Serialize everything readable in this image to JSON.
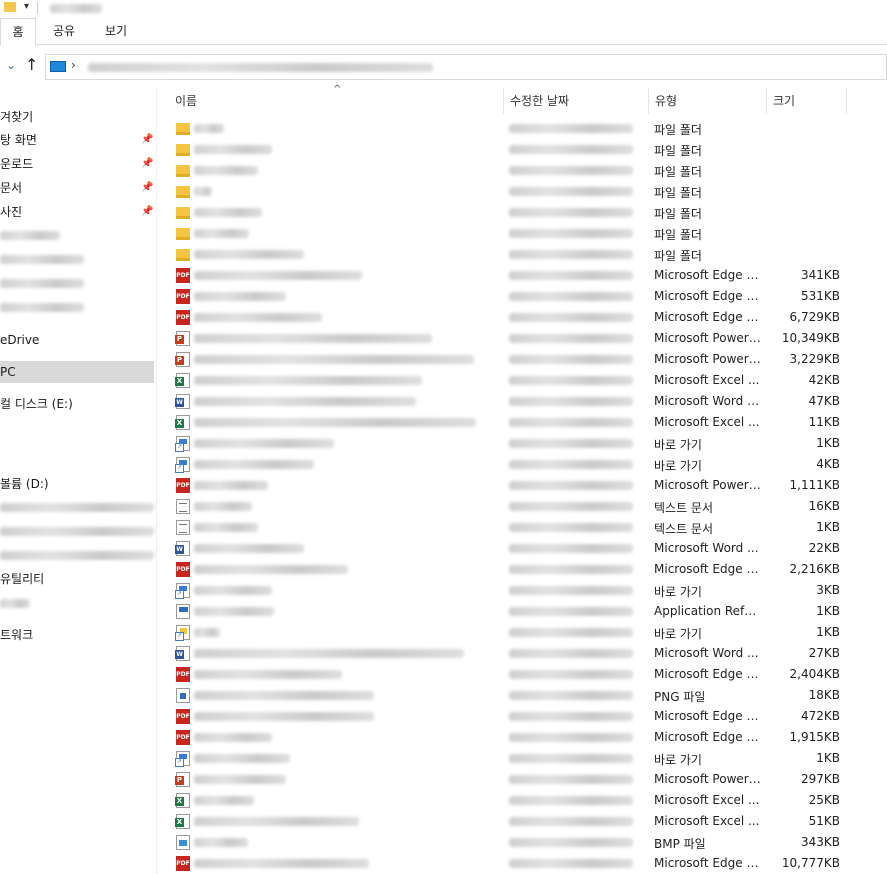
{
  "ribbon": {
    "tabs": [
      "홈",
      "공유",
      "보기"
    ]
  },
  "nav_pane": {
    "items": [
      {
        "label": "겨찾기",
        "pinned": false
      },
      {
        "label": "탕 화면",
        "pinned": true
      },
      {
        "label": "운로드",
        "pinned": true
      },
      {
        "label": "문서",
        "pinned": true
      },
      {
        "label": "사진",
        "pinned": true
      },
      {
        "label": "eDrive",
        "pinned": false
      },
      {
        "label": "PC",
        "pinned": false,
        "selected": true
      },
      {
        "label": "컬 디스크 (E:)",
        "pinned": false
      },
      {
        "label": "볼륨 (D:)",
        "pinned": false
      },
      {
        "label": "유틸리티",
        "pinned": false
      },
      {
        "label": "트워크",
        "pinned": false
      }
    ]
  },
  "columns": {
    "name": "이름",
    "date": "수정한 날짜",
    "type": "유형",
    "size": "크기"
  },
  "files": [
    {
      "icon": "folder-icon",
      "type": "파일 폴더",
      "size": ""
    },
    {
      "icon": "folder-icon",
      "type": "파일 폴더",
      "size": ""
    },
    {
      "icon": "folder-icon",
      "type": "파일 폴더",
      "size": ""
    },
    {
      "icon": "folder-icon",
      "type": "파일 폴더",
      "size": ""
    },
    {
      "icon": "folder-icon",
      "type": "파일 폴더",
      "size": ""
    },
    {
      "icon": "folder-icon",
      "type": "파일 폴더",
      "size": ""
    },
    {
      "icon": "folder-icon",
      "type": "파일 폴더",
      "size": ""
    },
    {
      "icon": "pdf-icon",
      "type": "Microsoft Edge P...",
      "size": "341KB"
    },
    {
      "icon": "pdf-icon",
      "type": "Microsoft Edge P...",
      "size": "531KB"
    },
    {
      "icon": "pdf-icon",
      "type": "Microsoft Edge P...",
      "size": "6,729KB"
    },
    {
      "icon": "powerpoint-icon",
      "type": "Microsoft PowerP...",
      "size": "10,349KB"
    },
    {
      "icon": "powerpoint-icon",
      "type": "Microsoft PowerP...",
      "size": "3,229KB"
    },
    {
      "icon": "excel-icon",
      "type": "Microsoft Excel ...",
      "size": "42KB"
    },
    {
      "icon": "word-icon",
      "type": "Microsoft Word 9...",
      "size": "47KB"
    },
    {
      "icon": "excel-icon",
      "type": "Microsoft Excel ...",
      "size": "11KB"
    },
    {
      "icon": "shortcut-icon",
      "type": "바로 가기",
      "size": "1KB"
    },
    {
      "icon": "shortcut-icon",
      "type": "바로 가기",
      "size": "4KB"
    },
    {
      "icon": "pdf-icon",
      "type": "Microsoft PowerP...",
      "size": "1,111KB"
    },
    {
      "icon": "text-file-icon",
      "type": "텍스트 문서",
      "size": "16KB"
    },
    {
      "icon": "text-file-icon",
      "type": "텍스트 문서",
      "size": "1KB"
    },
    {
      "icon": "word-icon",
      "type": "Microsoft Word ...",
      "size": "22KB"
    },
    {
      "icon": "pdf-icon",
      "type": "Microsoft Edge P...",
      "size": "2,216KB"
    },
    {
      "icon": "shortcut-icon",
      "type": "바로 가기",
      "size": "3KB"
    },
    {
      "icon": "application-reference-icon",
      "type": "Application Refer...",
      "size": "1KB"
    },
    {
      "icon": "folder-shortcut-icon",
      "type": "바로 가기",
      "size": "1KB"
    },
    {
      "icon": "word-icon",
      "type": "Microsoft Word ...",
      "size": "27KB"
    },
    {
      "icon": "pdf-icon",
      "type": "Microsoft Edge P...",
      "size": "2,404KB"
    },
    {
      "icon": "png-file-icon",
      "type": "PNG 파일",
      "size": "18KB"
    },
    {
      "icon": "pdf-icon",
      "type": "Microsoft Edge P...",
      "size": "472KB"
    },
    {
      "icon": "pdf-icon",
      "type": "Microsoft Edge P...",
      "size": "1,915KB"
    },
    {
      "icon": "shortcut-icon",
      "type": "바로 가기",
      "size": "1KB"
    },
    {
      "icon": "powerpoint-icon",
      "type": "Microsoft PowerP...",
      "size": "297KB"
    },
    {
      "icon": "excel-icon",
      "type": "Microsoft Excel ...",
      "size": "25KB"
    },
    {
      "icon": "excel-icon",
      "type": "Microsoft Excel ...",
      "size": "51KB"
    },
    {
      "icon": "bmp-file-icon",
      "type": "BMP 파일",
      "size": "343KB"
    },
    {
      "icon": "pdf-icon",
      "type": "Microsoft Edge P...",
      "size": "10,777KB"
    }
  ]
}
